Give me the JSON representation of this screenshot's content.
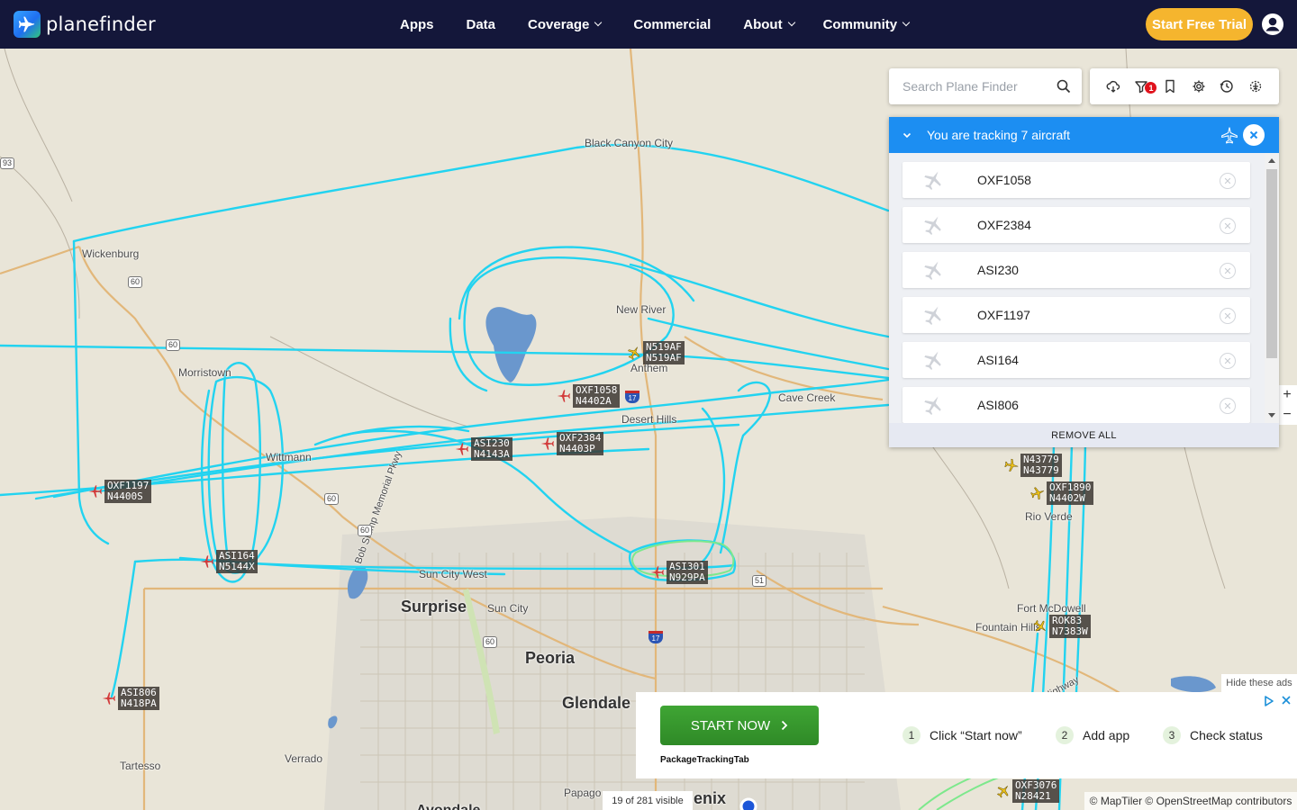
{
  "brand": {
    "name": "planefinder"
  },
  "nav": {
    "items": [
      {
        "label": "Apps",
        "dropdown": false
      },
      {
        "label": "Data",
        "dropdown": false
      },
      {
        "label": "Coverage",
        "dropdown": true
      },
      {
        "label": "Commercial",
        "dropdown": false
      },
      {
        "label": "About",
        "dropdown": true
      },
      {
        "label": "Community",
        "dropdown": true
      }
    ],
    "trial_label": "Start Free Trial"
  },
  "search": {
    "placeholder": "Search Plane Finder",
    "value": ""
  },
  "toolbar": {
    "icons": [
      "weather-cloud-icon",
      "filter-icon",
      "bookmark-icon",
      "settings-gear-icon",
      "history-clock-icon",
      "airport-icon"
    ],
    "filter_badge": "1"
  },
  "tracking": {
    "title": "You are tracking 7 aircraft",
    "items": [
      "OXF1058",
      "OXF2384",
      "ASI230",
      "OXF1197",
      "ASI164",
      "ASI806"
    ],
    "remove_all_label": "REMOVE ALL"
  },
  "map": {
    "places": [
      "Black Canyon City",
      "Wickenburg",
      "New River",
      "Anthem",
      "Morristown",
      "Cave Creek",
      "Desert Hills",
      "Wittmann",
      "Rio Verde",
      "Sun City West",
      "Surprise",
      "Sun City",
      "Peoria",
      "Glendale",
      "Fort McDowell",
      "Fountain Hills",
      "Verrado",
      "Tartesso",
      "Papago",
      "enix",
      "Avondale",
      "Bob Stump Memorial Pkwy",
      "Beeline Highway"
    ],
    "route_shields": [
      "60",
      "60",
      "60",
      "60",
      "60",
      "60",
      "51",
      "93",
      "17",
      "17"
    ],
    "aircraft": [
      {
        "callsign": "OXF1058",
        "reg": "N4402A",
        "color": "red"
      },
      {
        "callsign": "OXF2384",
        "reg": "N4403P",
        "color": "red"
      },
      {
        "callsign": "ASI230",
        "reg": "N4143A",
        "color": "red"
      },
      {
        "callsign": "OXF1197",
        "reg": "N4400S",
        "color": "red"
      },
      {
        "callsign": "ASI164",
        "reg": "N5144X",
        "color": "red"
      },
      {
        "callsign": "ASI806",
        "reg": "N418PA",
        "color": "red"
      },
      {
        "callsign": "ASI301",
        "reg": "N929PA",
        "color": "red"
      },
      {
        "callsign": "N519AF",
        "reg": "N519AF",
        "color": "yellow"
      },
      {
        "callsign": "N43779",
        "reg": "N43779",
        "color": "yellow"
      },
      {
        "callsign": "OXF1890",
        "reg": "N4402W",
        "color": "yellow"
      },
      {
        "callsign": "ROK83",
        "reg": "N7383W",
        "color": "yellow"
      },
      {
        "callsign": "OXF3076",
        "reg": "N28421",
        "color": "yellow"
      }
    ],
    "zoom_in": "+",
    "zoom_out": "−"
  },
  "ad": {
    "hide_label": "Hide these ads",
    "cta_label": "START NOW",
    "brand": "PackageTrackingTab",
    "steps": [
      {
        "num": "1",
        "label": "Click “Start now”"
      },
      {
        "num": "2",
        "label": "Add app"
      },
      {
        "num": "3",
        "label": "Check status"
      }
    ]
  },
  "status": {
    "visible_count": "19 of 281 visible",
    "attribution": "© MapTiler © OpenStreetMap contributors"
  },
  "colors": {
    "nav_bg": "#14173a",
    "trial_bg": "#f5b52e",
    "panel_head": "#1c8ef2",
    "track_line": "#22d3f0",
    "ad_green": "#3fa534"
  }
}
